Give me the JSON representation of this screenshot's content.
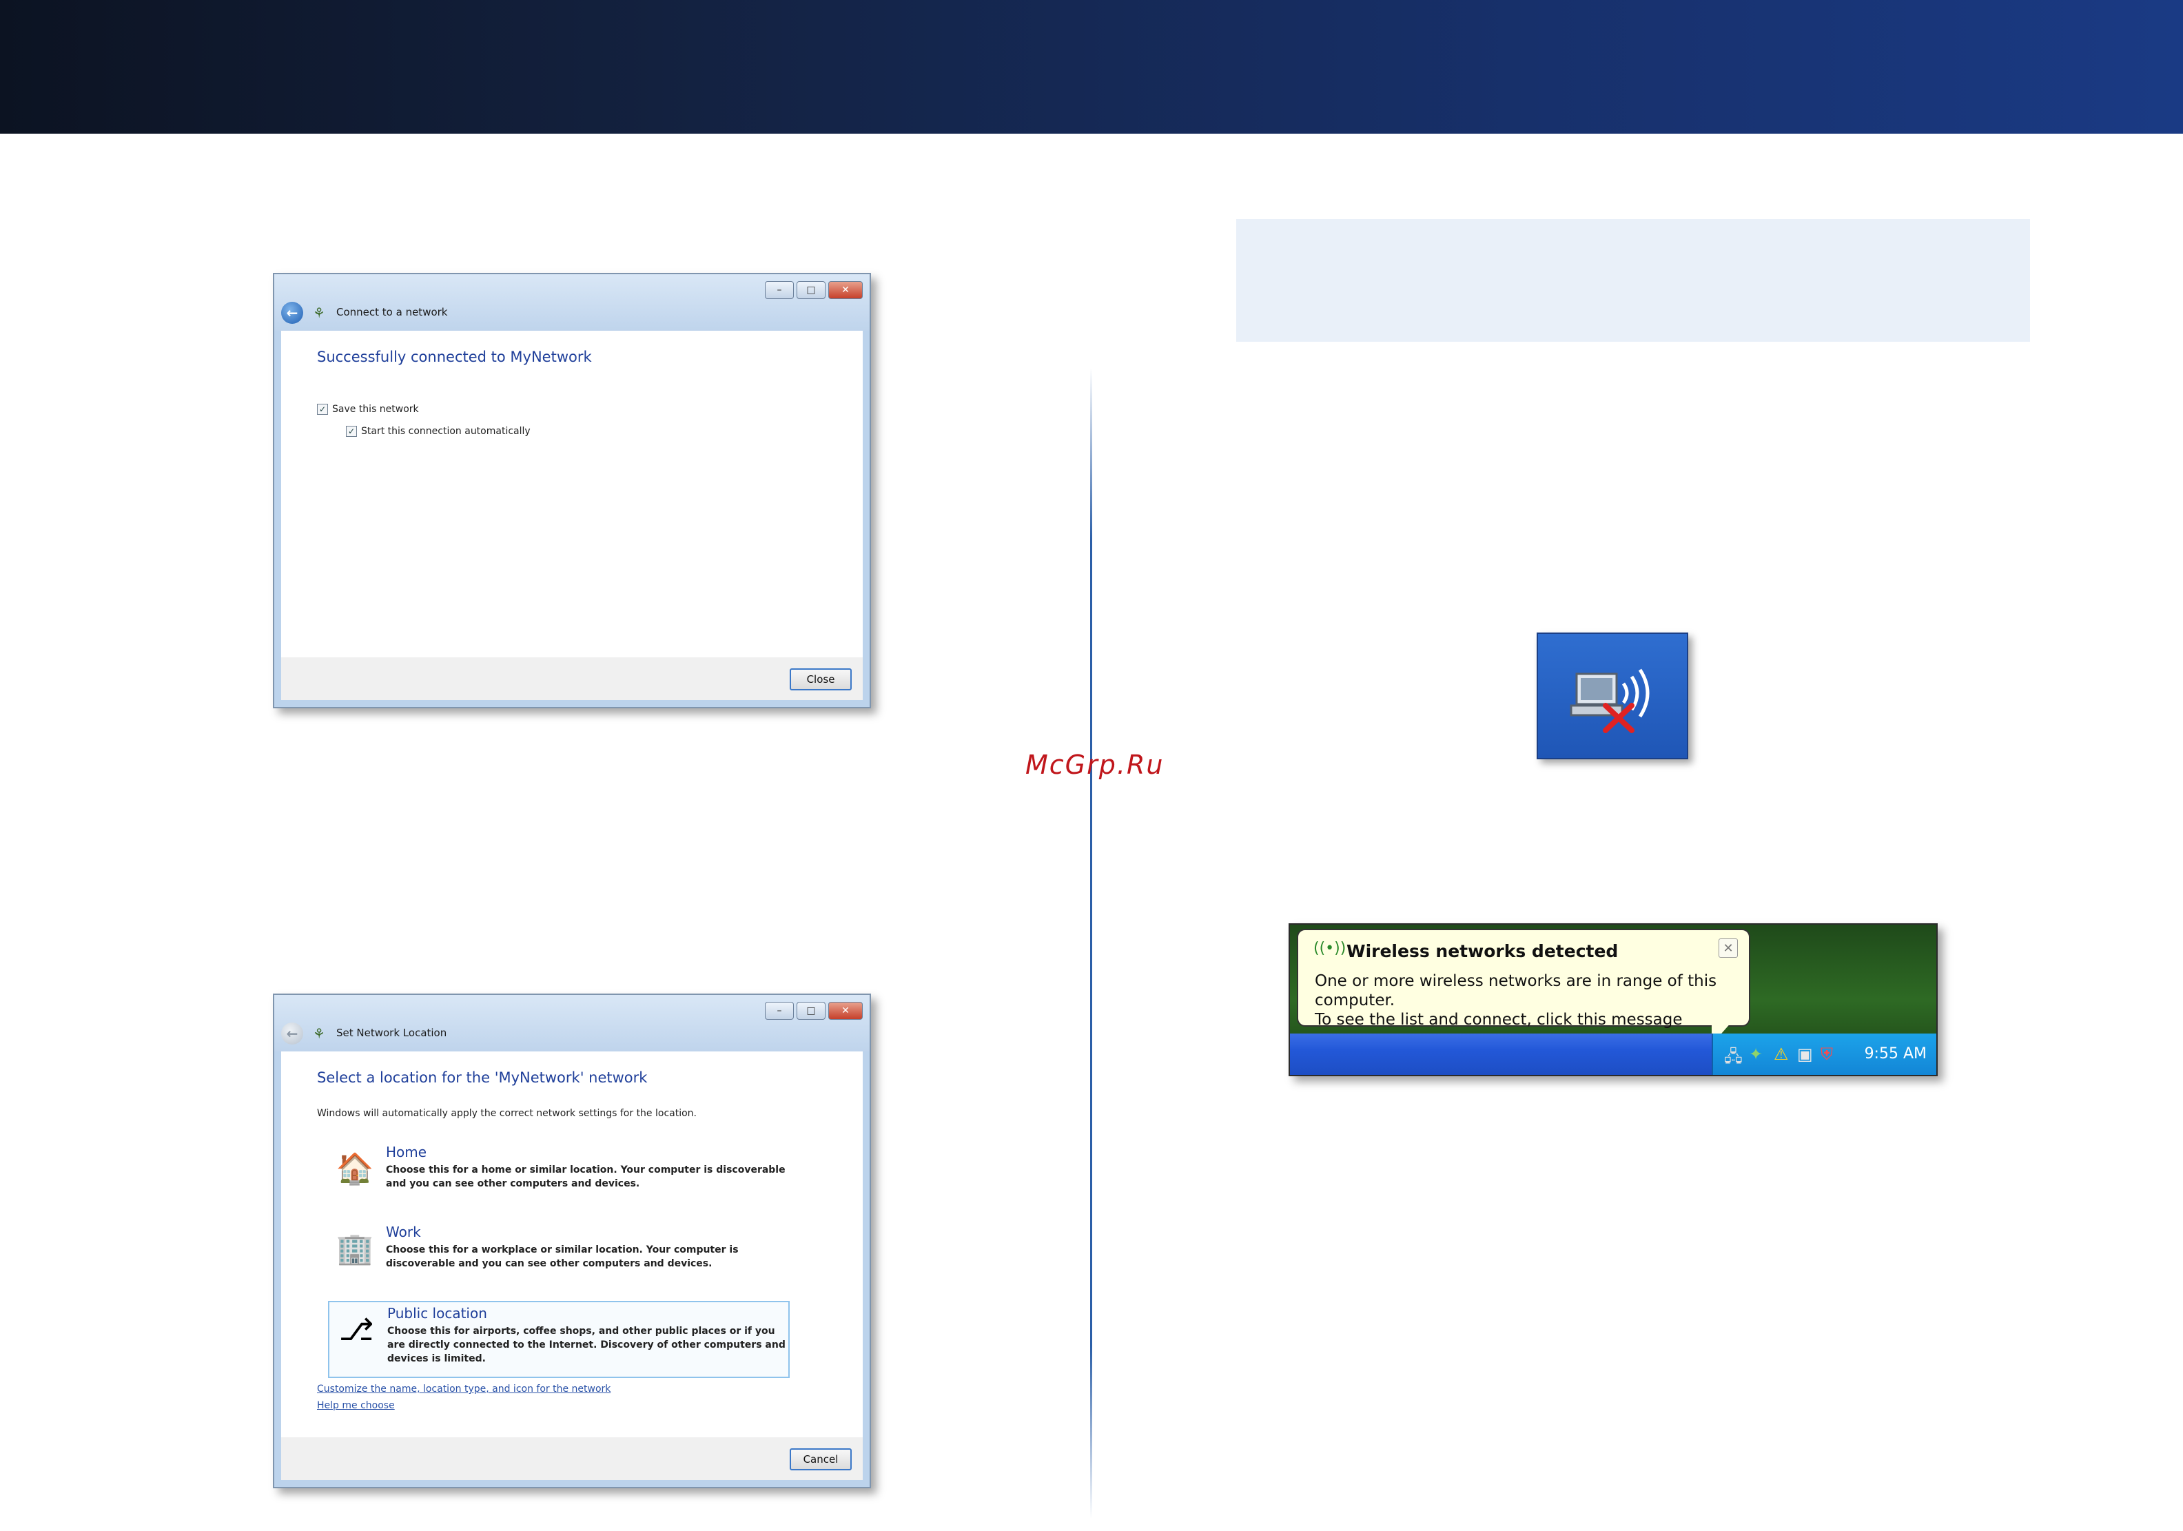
{
  "watermark": "McGrp.Ru",
  "dialog_connected": {
    "title": "Connect to a network",
    "heading": "Successfully connected to MyNetwork",
    "checkbox_save": "Save this network",
    "checkbox_auto": "Start this connection automatically",
    "close_button": "Close"
  },
  "dialog_location": {
    "title": "Set Network Location",
    "heading": "Select a location for the 'MyNetwork' network",
    "description": "Windows will automatically apply the correct network settings for the location.",
    "locations": [
      {
        "name": "Home",
        "description": "Choose this for a home or similar location. Your computer is discoverable and you can see other computers and devices."
      },
      {
        "name": "Work",
        "description": "Choose this for a workplace or similar location. Your computer is discoverable and you can see other computers and devices."
      },
      {
        "name": "Public location",
        "description": "Choose this for airports, coffee shops, and other public places or if you are directly connected to the Internet. Discovery of other computers and devices is limited."
      }
    ],
    "link_customize": "Customize the name, location type, and icon for the network",
    "link_help": "Help me choose",
    "cancel_button": "Cancel"
  },
  "xp_balloon": {
    "title": "Wireless networks detected",
    "line1": "One or more wireless networks are in range of this computer.",
    "line2": "To see the list and connect, click this message",
    "time": "9:55 AM"
  },
  "colors": {
    "banner": "#17306b",
    "note_box": "#e9f0f9",
    "heading_blue": "#1f3f9a",
    "watermark": "#c0161b"
  }
}
